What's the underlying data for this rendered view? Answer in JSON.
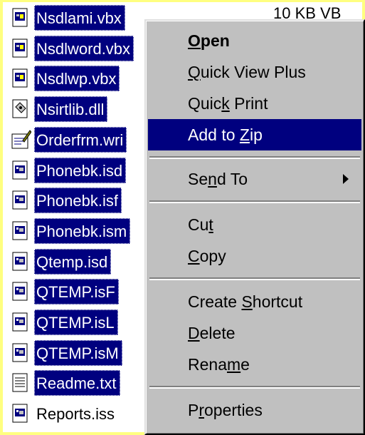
{
  "files": [
    {
      "name": "Nsdlami.vbx",
      "icon": "vbx-file-icon",
      "selected": true
    },
    {
      "name": "Nsdlword.vbx",
      "icon": "vbx-file-icon",
      "selected": true
    },
    {
      "name": "Nsdlwp.vbx",
      "icon": "vbx-file-icon",
      "selected": true
    },
    {
      "name": "Nsirtlib.dll",
      "icon": "dll-file-icon",
      "selected": true
    },
    {
      "name": "Orderfrm.wri",
      "icon": "write-document-icon",
      "selected": true
    },
    {
      "name": "Phonebk.isd",
      "icon": "iss-file-icon",
      "selected": true
    },
    {
      "name": "Phonebk.isf",
      "icon": "iss-file-icon",
      "selected": true
    },
    {
      "name": "Phonebk.ism",
      "icon": "iss-file-icon",
      "selected": true
    },
    {
      "name": "Qtemp.isd",
      "icon": "iss-file-icon",
      "selected": true
    },
    {
      "name": "QTEMP.isF",
      "icon": "iss-file-icon",
      "selected": true
    },
    {
      "name": "QTEMP.isL",
      "icon": "iss-file-icon",
      "selected": true
    },
    {
      "name": "QTEMP.isM",
      "icon": "iss-file-icon",
      "selected": true
    },
    {
      "name": "Readme.txt",
      "icon": "text-file-icon",
      "selected": true
    },
    {
      "name": "Reports.iss",
      "icon": "iss-file-icon",
      "selected": false
    }
  ],
  "size_column": "10 KB    VB",
  "context_menu": {
    "open": "Open",
    "quick_view_plus": "Quick View Plus",
    "quick_print": "Quick Print",
    "add_to_zip": "Add to Zip",
    "send_to": "Send To",
    "cut": "Cut",
    "copy": "Copy",
    "create_shortcut": "Create Shortcut",
    "delete": "Delete",
    "rename": "Rename",
    "properties": "Properties"
  },
  "colors": {
    "selection": "#00007f",
    "menu_face": "#c0c0c0",
    "frame": "#ffff80"
  }
}
